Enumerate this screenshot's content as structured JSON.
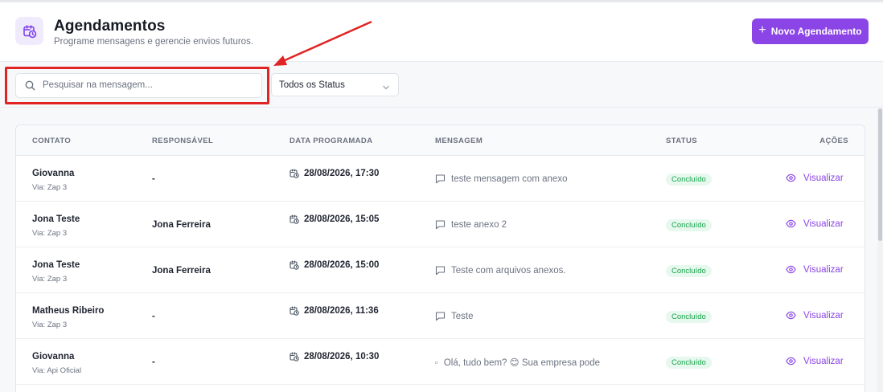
{
  "header": {
    "title": "Agendamentos",
    "subtitle": "Programe mensagens e gerencie envios futuros.",
    "icon": "calendar-clock-icon",
    "new_button": "Novo Agendamento"
  },
  "filters": {
    "search_placeholder": "Pesquisar na mensagem...",
    "status_value": "Todos os Status"
  },
  "table": {
    "columns": {
      "contato": "CONTATO",
      "responsavel": "RESPONSÁVEL",
      "data": "DATA PROGRAMADA",
      "mensagem": "MENSAGEM",
      "status": "STATUS",
      "acoes": "AÇÕES"
    },
    "rows": [
      {
        "name": "Giovanna",
        "via": "Via: Zap 3",
        "resp": "-",
        "date": "28/08/2026, 17:30",
        "msg": "teste mensagem com anexo",
        "status": "Concluído",
        "action": "Visualizar"
      },
      {
        "name": "Jona Teste",
        "via": "Via: Zap 3",
        "resp": "Jona Ferreira",
        "date": "28/08/2026, 15:05",
        "msg": "teste anexo 2",
        "status": "Concluído",
        "action": "Visualizar"
      },
      {
        "name": "Jona Teste",
        "via": "Via: Zap 3",
        "resp": "Jona Ferreira",
        "date": "28/08/2026, 15:00",
        "msg": "Teste com arquivos anexos.",
        "status": "Concluído",
        "action": "Visualizar"
      },
      {
        "name": "Matheus Ribeiro",
        "via": "Via: Zap 3",
        "resp": "-",
        "date": "28/08/2026, 11:36",
        "msg": "Teste",
        "status": "Concluído",
        "action": "Visualizar"
      },
      {
        "name": "Giovanna",
        "via": "Via: Api Oficial",
        "resp": "-",
        "date": "28/08/2026, 10:30",
        "msg": "Olá, tudo bem? 😊 Sua empresa pode",
        "status": "Concluído",
        "action": "Visualizar"
      }
    ]
  },
  "colors": {
    "accent": "#8b45e6",
    "success_bg": "#e7f8ee",
    "success_text": "#16a34a",
    "annotation": "#e02424"
  }
}
